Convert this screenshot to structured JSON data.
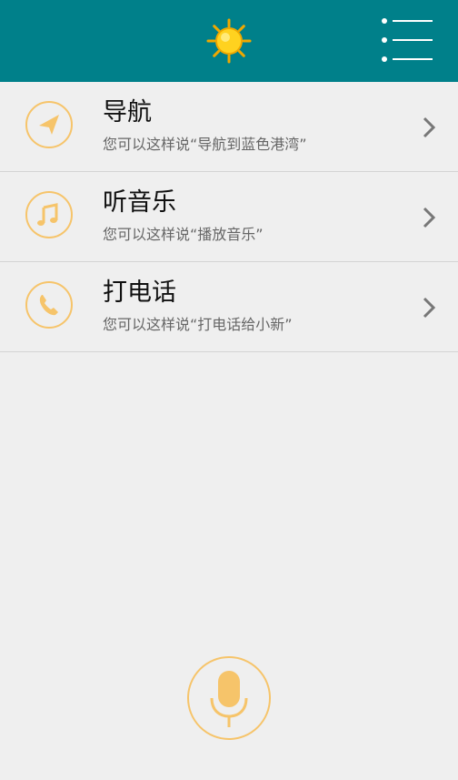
{
  "header": {
    "weather_icon": "sun-icon",
    "menu_icon": "menu-list-icon",
    "background_color": "#00808a"
  },
  "items": [
    {
      "title": "导航",
      "hint": "您可以这样说“导航到蓝色港湾”",
      "icon": "navigation-arrow-icon"
    },
    {
      "title": "听音乐",
      "hint": "您可以这样说“播放音乐”",
      "icon": "music-note-icon"
    },
    {
      "title": "打电话",
      "hint": "您可以这样说“打电话给小新”",
      "icon": "phone-icon"
    }
  ],
  "voice": {
    "icon": "microphone-icon",
    "accent_color": "#f6c46a"
  }
}
